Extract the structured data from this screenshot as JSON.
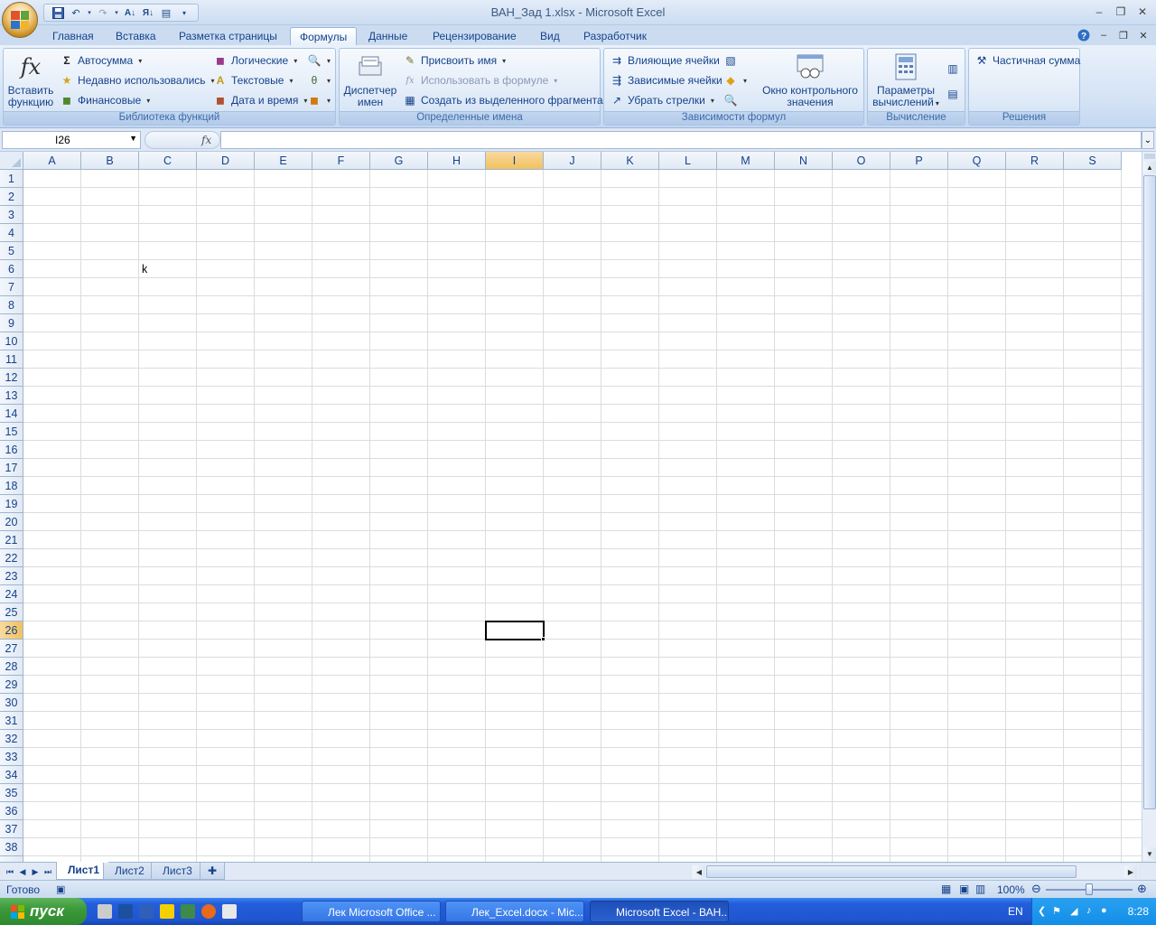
{
  "window": {
    "title": "ВАН_Зад 1.xlsx - Microsoft Excel"
  },
  "tabs": [
    {
      "label": "Главная"
    },
    {
      "label": "Вставка"
    },
    {
      "label": "Разметка страницы"
    },
    {
      "label": "Формулы",
      "active": true
    },
    {
      "label": "Данные"
    },
    {
      "label": "Рецензирование"
    },
    {
      "label": "Вид"
    },
    {
      "label": "Разработчик"
    }
  ],
  "ribbon": {
    "function_library": {
      "title": "Библиотека функций",
      "insert_function": "Вставить функцию",
      "insert_function_line1": "Вставить",
      "insert_function_line2": "функцию",
      "autosum": "Автосумма",
      "recent": "Недавно использовались",
      "financial": "Финансовые",
      "logical": "Логические",
      "text": "Текстовые",
      "datetime": "Дата и время"
    },
    "defined_names": {
      "title": "Определенные имена",
      "manager_line1": "Диспетчер",
      "manager_line2": "имен",
      "define_name": "Присвоить имя",
      "use_in_formula": "Использовать в формуле",
      "create_from_selection": "Создать из выделенного фрагмента"
    },
    "formula_auditing": {
      "title": "Зависимости формул",
      "trace_precedents": "Влияющие ячейки",
      "trace_dependents": "Зависимые ячейки",
      "remove_arrows": "Убрать стрелки",
      "watch_line1": "Окно контрольного",
      "watch_line2": "значения"
    },
    "calculation": {
      "title": "Вычисление",
      "options_line1": "Параметры",
      "options_line2": "вычислений"
    },
    "solutions": {
      "title": "Решения",
      "partial_sum": "Частичная сумма"
    }
  },
  "formula_bar": {
    "name_box": "I26",
    "fx": "fx",
    "value": ""
  },
  "grid": {
    "columns": [
      "A",
      "B",
      "C",
      "D",
      "E",
      "F",
      "G",
      "H",
      "I",
      "J",
      "K",
      "L",
      "M",
      "N",
      "O",
      "P",
      "Q",
      "R",
      "S"
    ],
    "rows": [
      "1",
      "2",
      "3",
      "4",
      "5",
      "6",
      "7",
      "8",
      "9",
      "10",
      "11",
      "12",
      "13",
      "14",
      "15",
      "16",
      "17",
      "18",
      "19",
      "20",
      "21",
      "22",
      "23",
      "24",
      "25",
      "26",
      "27",
      "28",
      "29",
      "30",
      "31",
      "32",
      "33",
      "34",
      "35",
      "36",
      "37",
      "38"
    ],
    "selected_column": "I",
    "selected_row": "26",
    "cells": [
      {
        "ref": "C6",
        "value": "k"
      }
    ]
  },
  "sheets": [
    {
      "label": "Лист1",
      "active": true
    },
    {
      "label": "Лист2"
    },
    {
      "label": "Лист3"
    }
  ],
  "status": {
    "ready": "Готово",
    "zoom": "100%"
  },
  "taskbar": {
    "start": "пуск",
    "tasks": [
      {
        "label": "Лек Microsoft Office ..."
      },
      {
        "label": "Лек_Excel.docx - Mic..."
      },
      {
        "label": "Microsoft Excel - ВАН...",
        "active": true
      }
    ],
    "lang": "EN",
    "clock": "8:28"
  },
  "colors": {
    "accent": "#15428b",
    "selection_header": "#f9d99f",
    "taskbar": "#245edb"
  }
}
